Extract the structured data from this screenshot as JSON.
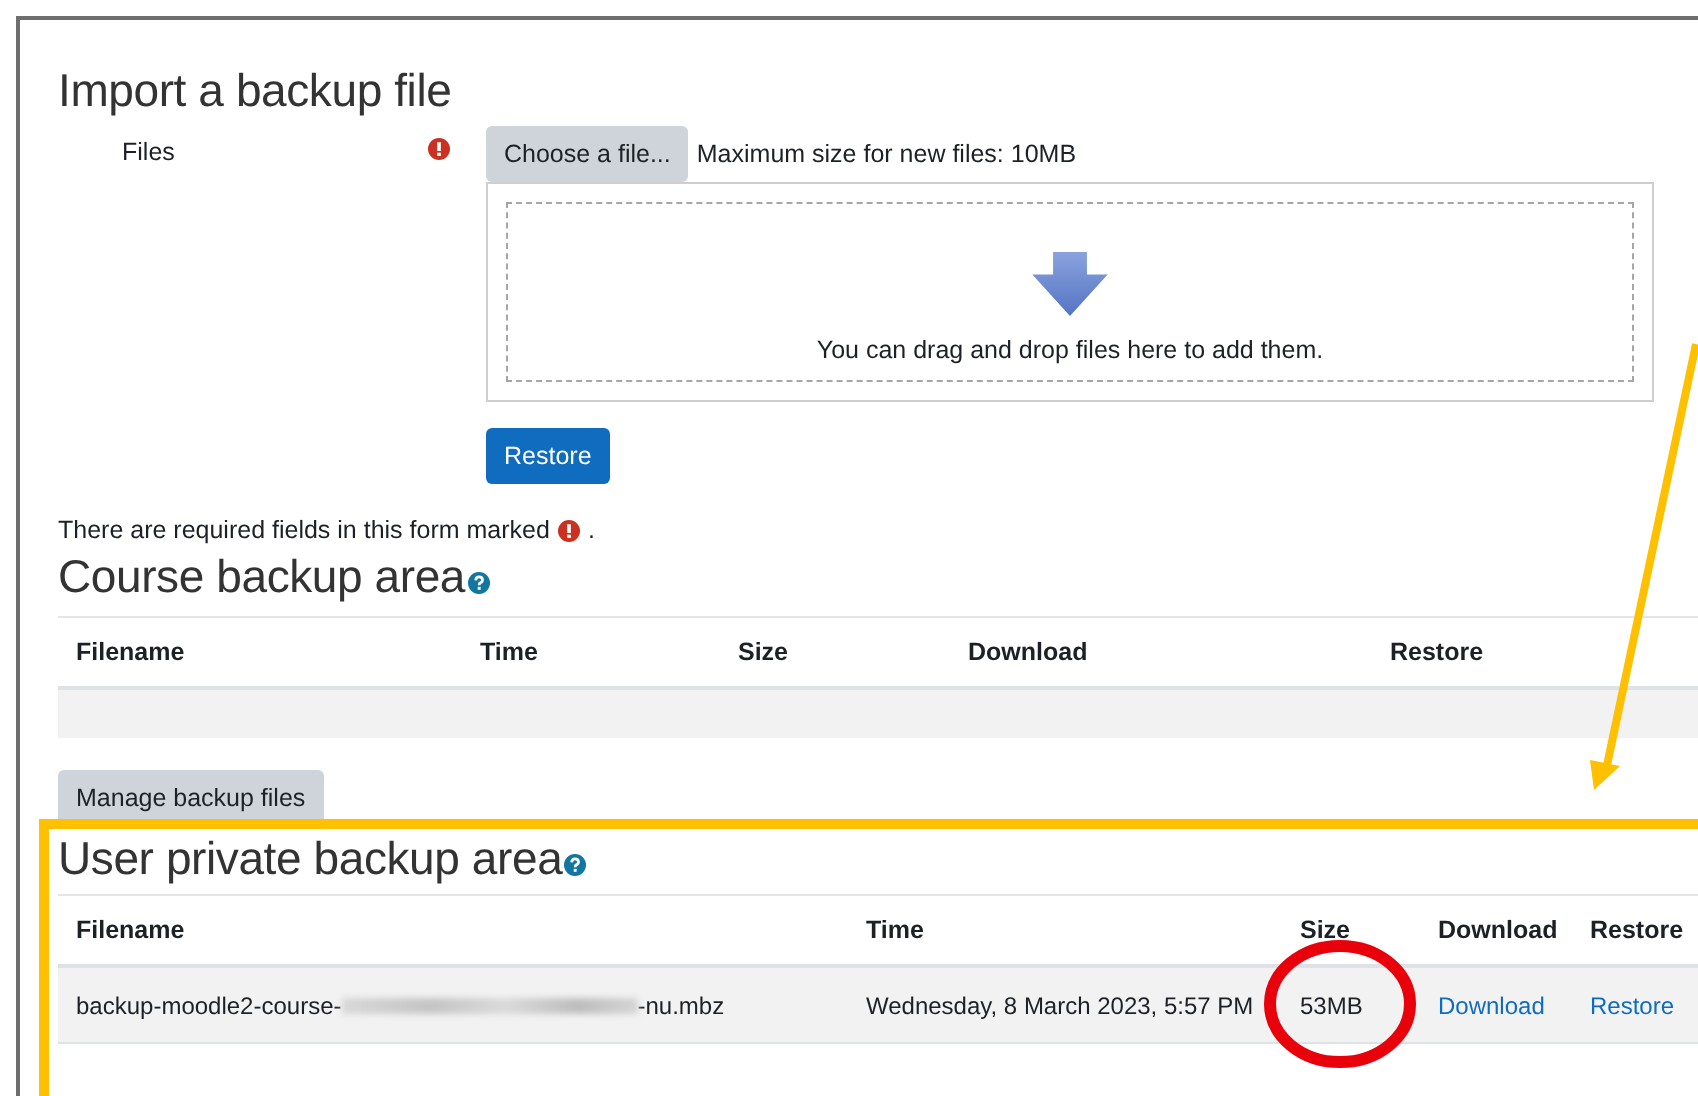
{
  "import_section": {
    "title": "Import a backup file",
    "files_label": "Files",
    "required": true,
    "choose_button": "Choose a file...",
    "max_size": "Maximum size for new files: 10MB",
    "drop_hint": "You can drag and drop files here to add them.",
    "restore_button": "Restore",
    "required_note": "There are required fields in this form marked",
    "required_note_end": "."
  },
  "course_backup": {
    "title": "Course backup area",
    "help": true,
    "columns": [
      "Filename",
      "Time",
      "Size",
      "Download",
      "Restore"
    ],
    "manage_button": "Manage backup files"
  },
  "user_backup": {
    "title": "User private backup area",
    "help": true,
    "columns": [
      "Filename",
      "Time",
      "Size",
      "Download",
      "Restore"
    ],
    "rows": [
      {
        "filename_start": "backup-moodle2-course-",
        "filename_end": "-nu.mbz",
        "redacted": true,
        "time": "Wednesday, 8 March 2023, 5:57 PM",
        "size": "53MB",
        "download": "Download",
        "restore": "Restore",
        "highlighted": true
      }
    ]
  }
}
